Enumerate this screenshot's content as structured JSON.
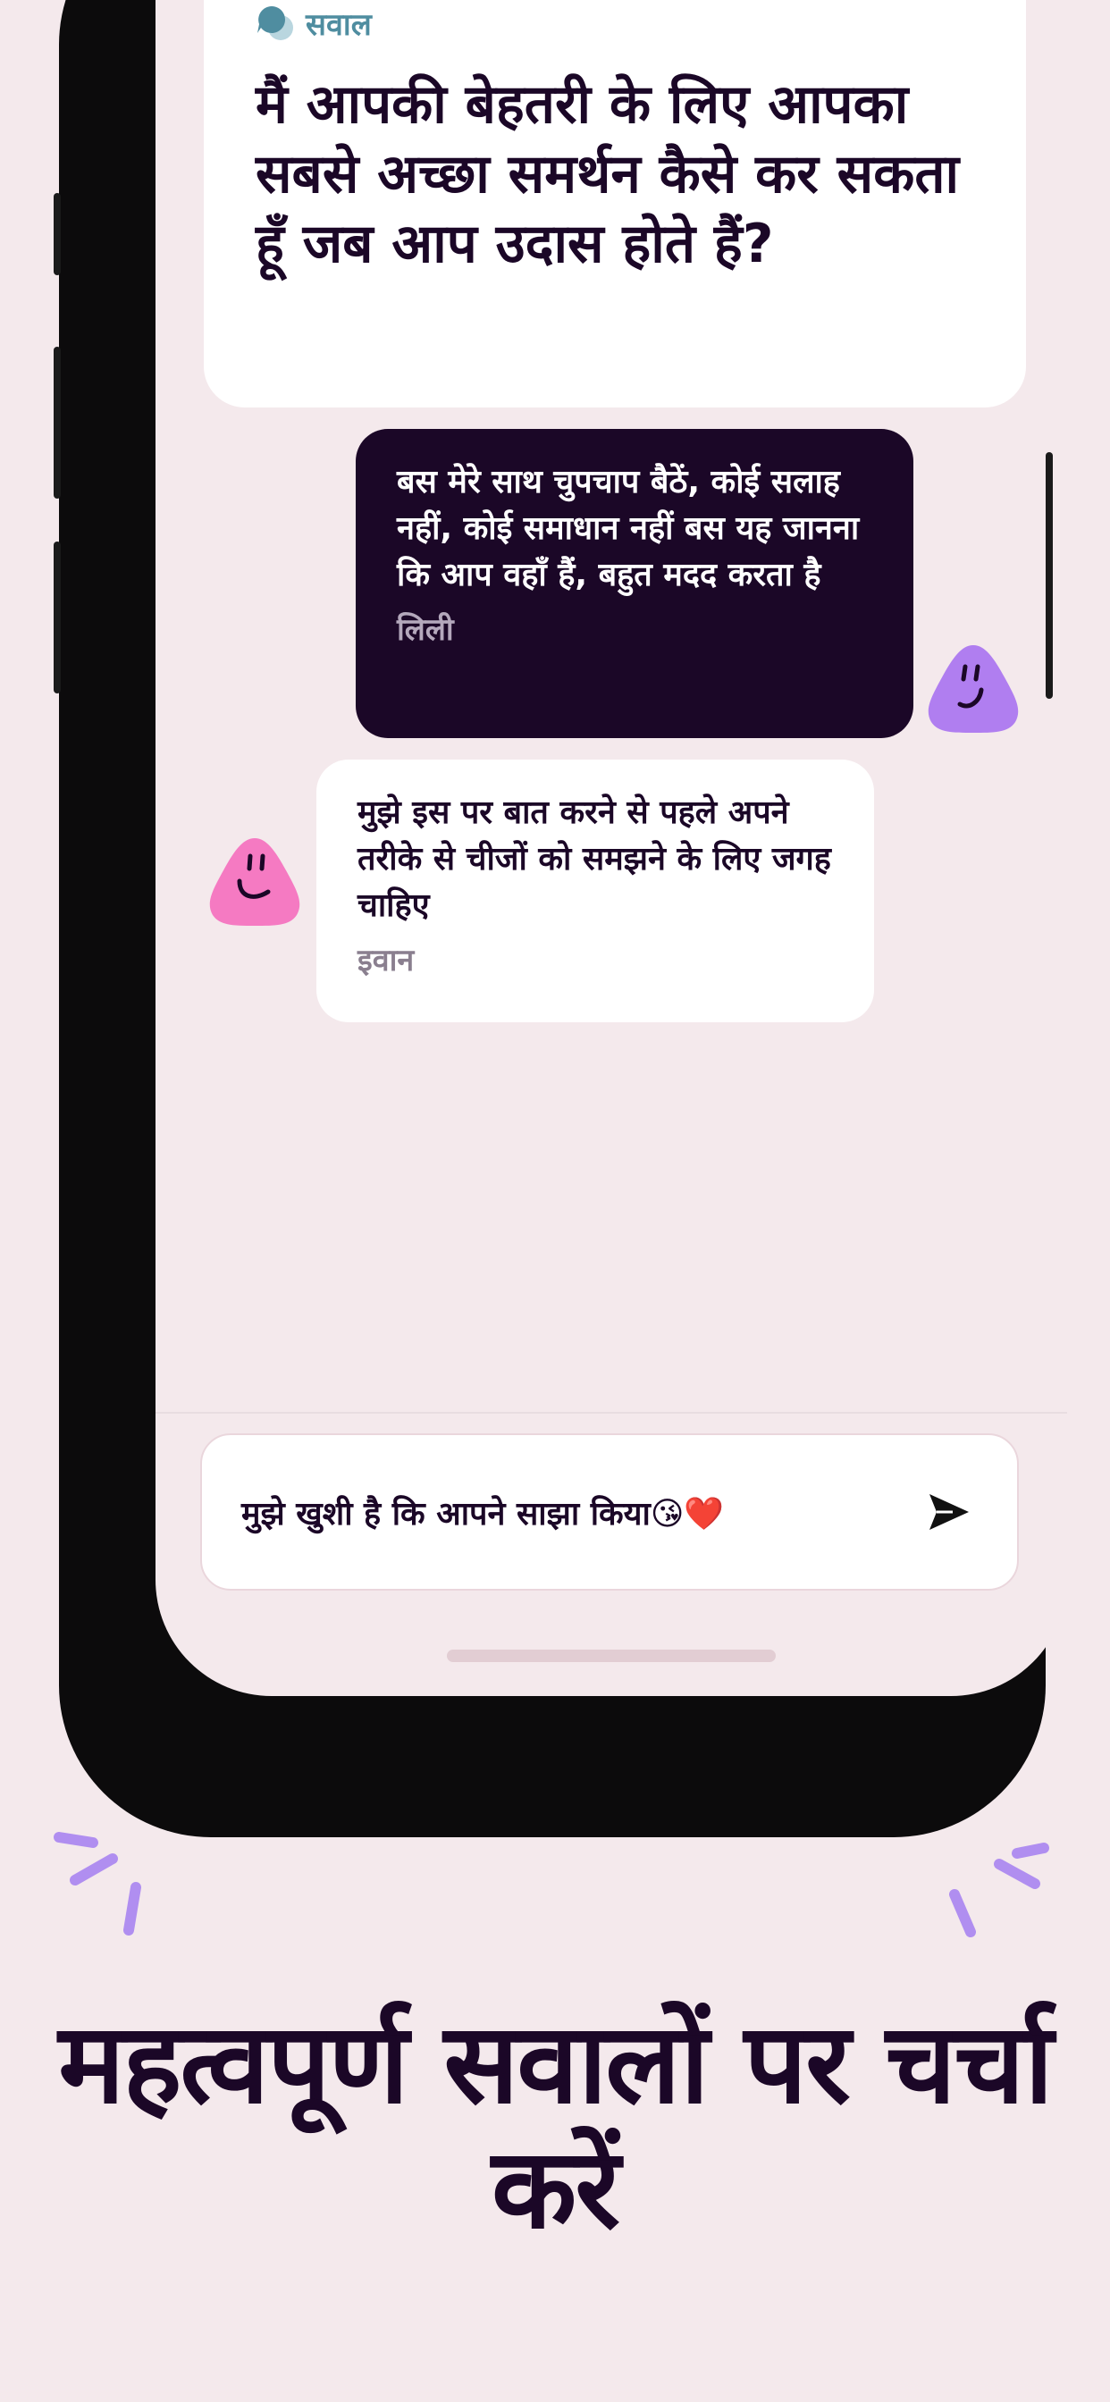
{
  "question_card": {
    "label": "सवाल",
    "text": "मैं आपकी बेहतरी के लिए आपका सबसे अच्छा समर्थन कैसे कर सकता हूँ जब आप उदास होते हैं?"
  },
  "messages": [
    {
      "text": "बस मेरे साथ चुपचाप बैठें, कोई सलाह नहीं, कोई समाधान नहीं बस यह जानना कि आप वहाँ हैं, बहुत मदद करता है",
      "author": "लिली",
      "avatar_color": "#b07ef0"
    },
    {
      "text": "मुझे इस पर बात करने से पहले अपने तरीके से चीजों को समझने के लिए जगह चाहिए",
      "author": "इवान",
      "avatar_color": "#f57ac2"
    }
  ],
  "composer": {
    "value": "मुझे खुशी है कि आपने साझा किया😘❤️",
    "send_icon": "send-arrow-icon"
  },
  "headline": "महत्वपूर्ण सवालों पर चर्चा करें",
  "colors": {
    "background": "#f4e9ec",
    "dark_text": "#1b0727",
    "label_teal": "#4f8da0",
    "spark_purple": "#b08ef0"
  }
}
